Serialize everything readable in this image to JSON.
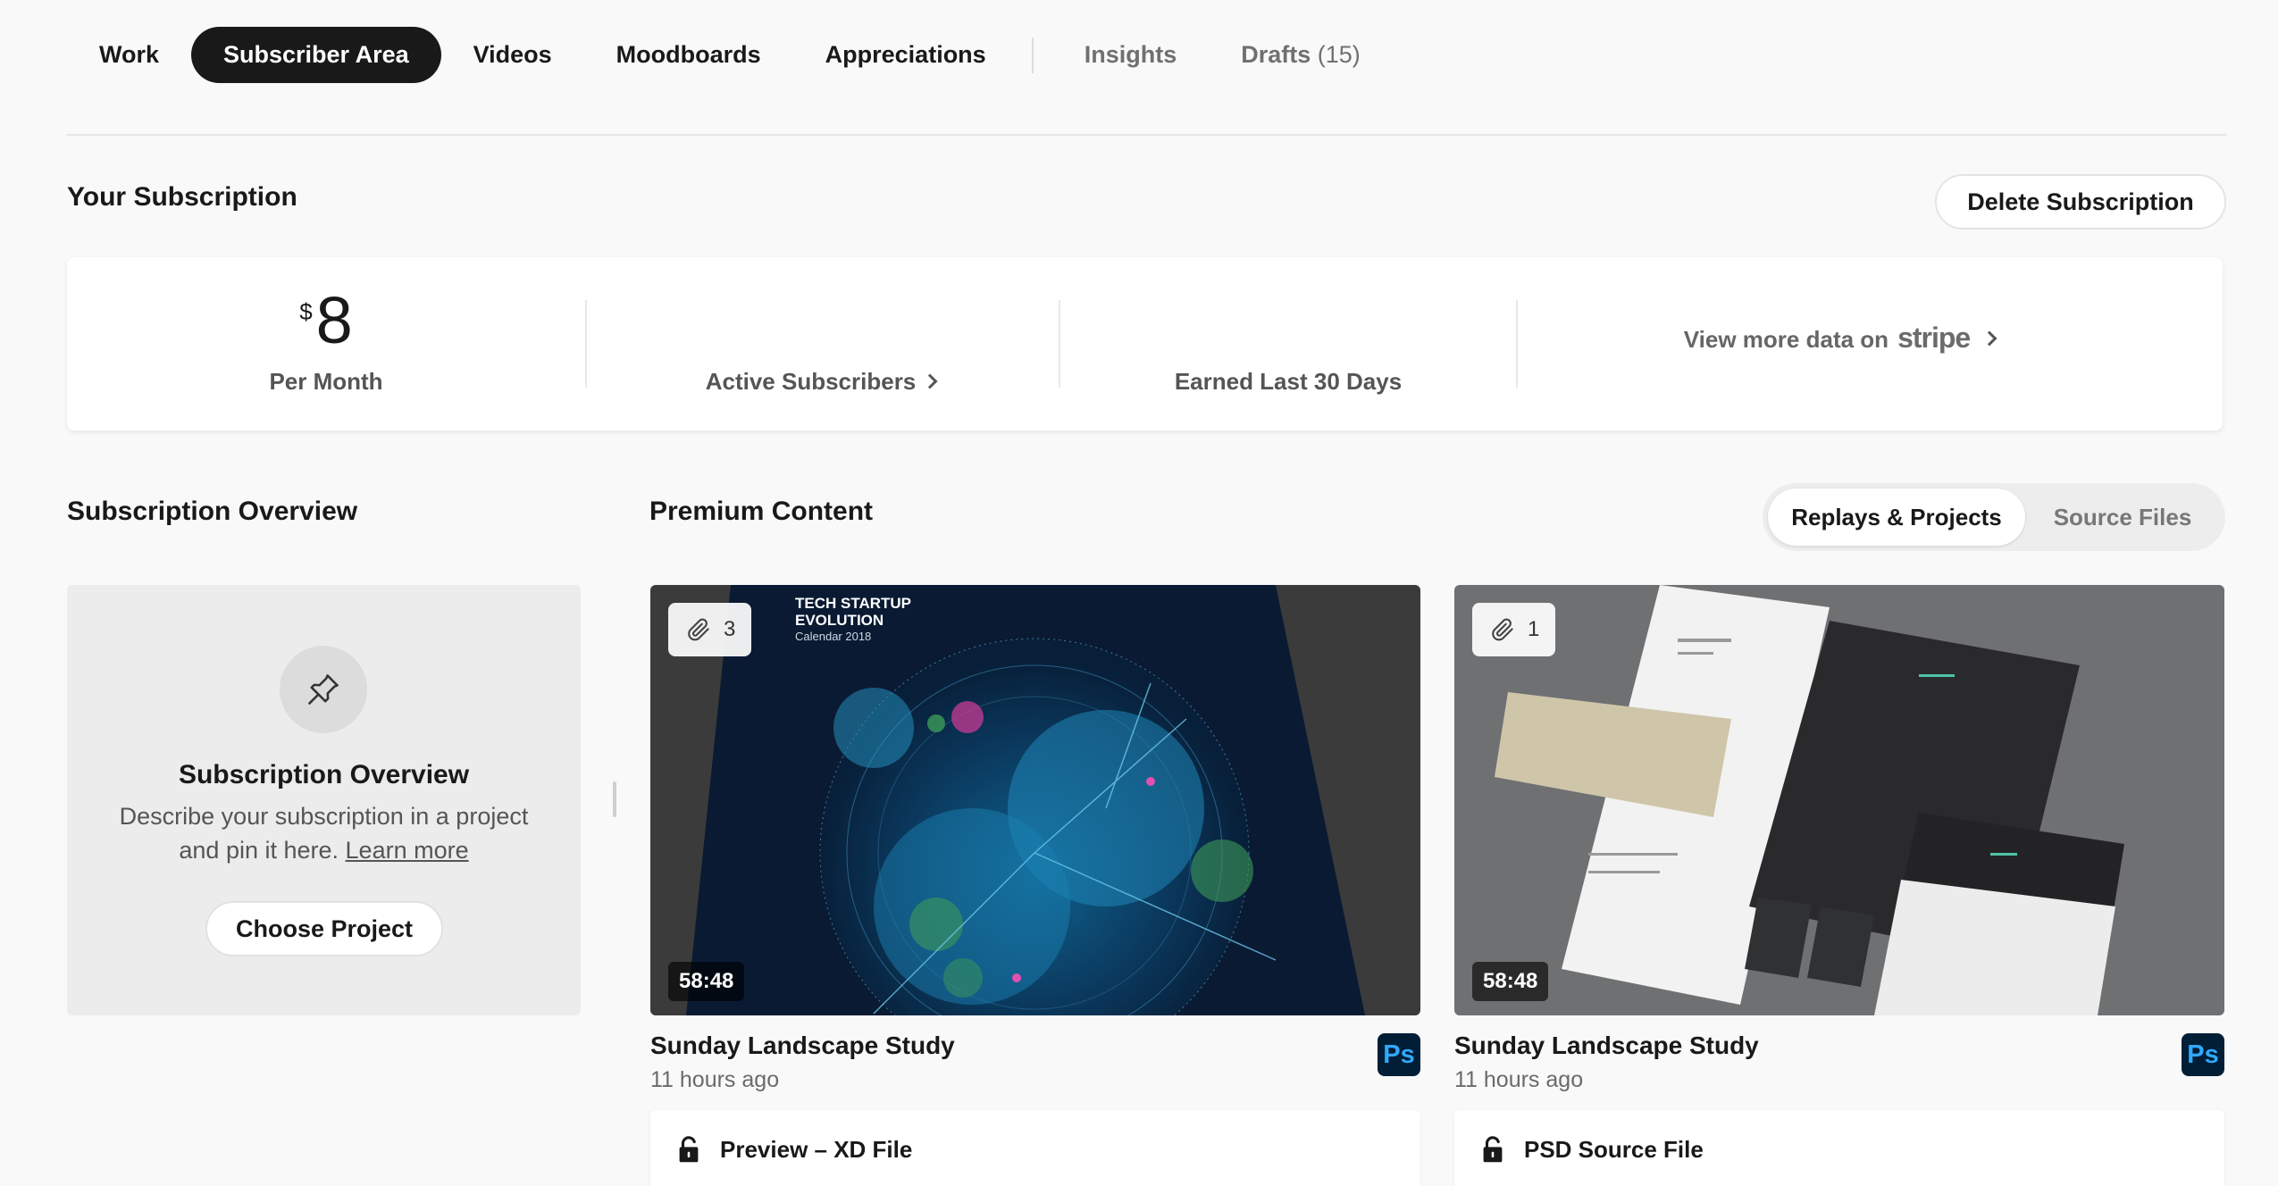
{
  "tabs": [
    {
      "label": "Work"
    },
    {
      "label": "Subscriber Area",
      "active": true
    },
    {
      "label": "Videos"
    },
    {
      "label": "Moodboards"
    },
    {
      "label": "Appreciations"
    },
    {
      "label": "Insights"
    },
    {
      "label": "Drafts",
      "count": "(15)"
    }
  ],
  "subscription": {
    "title": "Your Subscription",
    "delete_label": "Delete Subscription",
    "currency": "$",
    "price": "8",
    "price_label": "Per Month",
    "subscribers_label": "Active Subscribers",
    "earned_label": "Earned Last 30 Days",
    "stripe_text": "View more data on",
    "stripe_brand": "stripe"
  },
  "overview": {
    "section_title": "Subscription Overview",
    "card_title": "Subscription Overview",
    "desc": "Describe your subscription in a project and pin it here.",
    "learn_more": "Learn more",
    "choose_label": "Choose Project"
  },
  "premium": {
    "title": "Premium Content",
    "toggle_on": "Replays & Projects",
    "toggle_off": "Source Files",
    "cards": [
      {
        "attachments": "3",
        "duration": "58:48",
        "title": "Sunday Landscape Study",
        "time": "11 hours ago",
        "app": "Ps",
        "file": "Preview – XD File",
        "thumb_text": {
          "line1": "TECH STARTUP",
          "line2": "EVOLUTION",
          "line3": "Calendar 2018"
        }
      },
      {
        "attachments": "1",
        "duration": "58:48",
        "title": "Sunday Landscape Study",
        "time": "11 hours ago",
        "app": "Ps",
        "file": "PSD Source File"
      }
    ]
  },
  "colors": {
    "accent_dark": "#191919",
    "ps_bg": "#001e36",
    "ps_fg": "#31a8ff",
    "page_bg": "#f9f9f9"
  }
}
